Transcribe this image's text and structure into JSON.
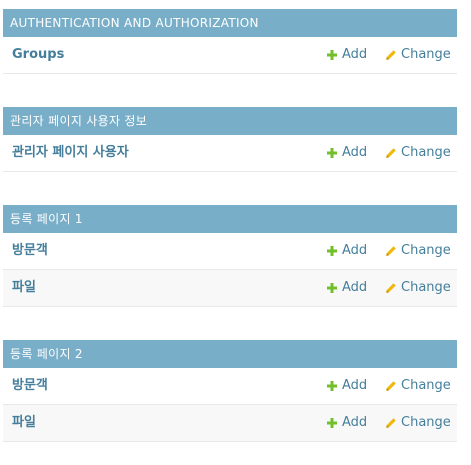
{
  "colors": {
    "caption_bg": "#79aec8",
    "link": "#447e9b",
    "add_icon": "#70bf2b",
    "change_icon": "#efb80b"
  },
  "icons": {
    "add": "plus-icon",
    "change": "pencil-icon"
  },
  "modules": [
    {
      "caption": "AUTHENTICATION AND AUTHORIZATION",
      "models": [
        {
          "name": "Groups",
          "add": "Add",
          "change": "Change"
        }
      ]
    },
    {
      "caption": "관리자 페이지 사용자 정보",
      "models": [
        {
          "name": "관리자 페이지 사용자",
          "add": "Add",
          "change": "Change"
        }
      ]
    },
    {
      "caption": "등록 페이지 1",
      "models": [
        {
          "name": "방문객",
          "add": "Add",
          "change": "Change"
        },
        {
          "name": "파일",
          "add": "Add",
          "change": "Change"
        }
      ]
    },
    {
      "caption": "등록 페이지 2",
      "models": [
        {
          "name": "방문객",
          "add": "Add",
          "change": "Change"
        },
        {
          "name": "파일",
          "add": "Add",
          "change": "Change"
        }
      ]
    }
  ]
}
